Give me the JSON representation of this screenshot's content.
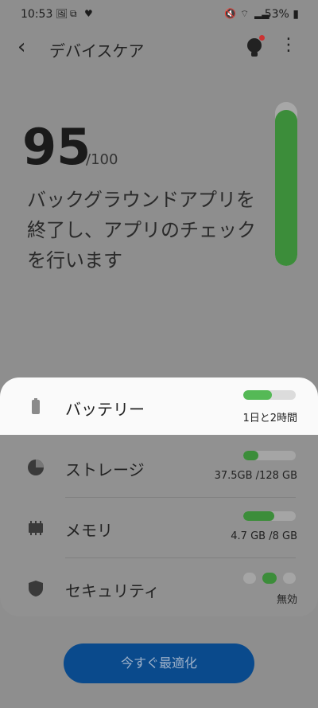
{
  "status": {
    "time": "10:53",
    "left_icons": [
      "image-icon",
      "screenshot-icon",
      "heart-icon"
    ],
    "right_icons": [
      "mute-icon",
      "wifi-icon",
      "signal-icon"
    ],
    "battery": "53%"
  },
  "header": {
    "title": "デバイスケア",
    "back_icon": "chevron-left-icon",
    "tips_icon": "lightbulb-icon",
    "more_icon": "more-vert-icon"
  },
  "summary": {
    "score": "95",
    "score_max": "/100",
    "description": "バックグラウンドアプリを終了し、アプリのチェックを行います",
    "gauge_level_fraction": 0.95
  },
  "items": [
    {
      "label": "バッテリー",
      "value": "1日と2時間",
      "fill_fraction": 0.55,
      "icon": "battery-icon"
    },
    {
      "label": "ストレージ",
      "value": "37.5GB /128 GB",
      "fill_fraction": 0.29,
      "icon": "pie-chart-icon"
    },
    {
      "label": "メモリ",
      "value": "4.7 GB /8 GB",
      "fill_fraction": 0.59,
      "icon": "memory-chip-icon"
    },
    {
      "label": "セキュリティ",
      "value": "無効",
      "icon": "shield-icon"
    }
  ],
  "actions": {
    "optimize_label": "今すぐ最適化"
  },
  "colors": {
    "accent_green": "#3c8d3a",
    "button_blue": "#0a4a8c"
  }
}
